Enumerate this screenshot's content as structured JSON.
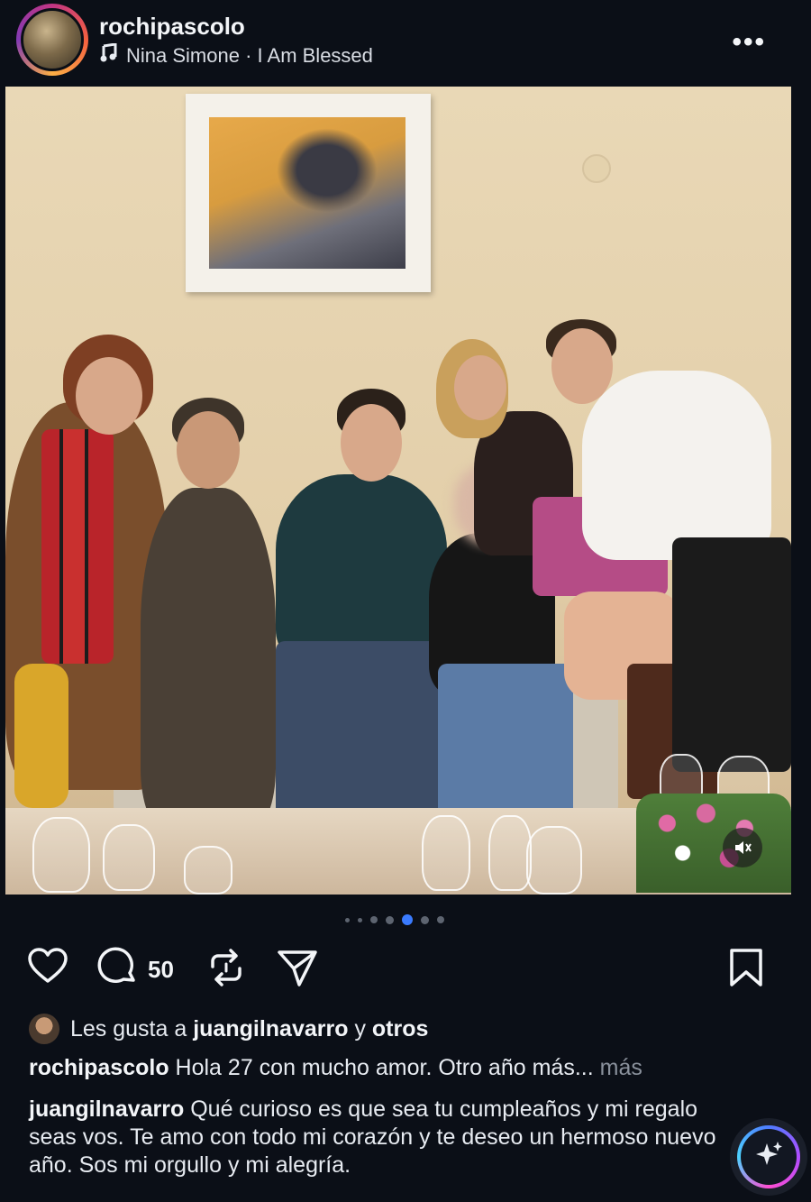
{
  "post": {
    "username": "rochipascolo",
    "music": "Nina Simone · I Am Blessed",
    "more_label": "•••"
  },
  "carousel": {
    "slide_count": 7,
    "active_index": 4
  },
  "actions": {
    "comment_count": "50"
  },
  "likes": {
    "prefix": "Les gusta a",
    "user": "juangilnavarro",
    "connector": "y",
    "others": "otros"
  },
  "caption": {
    "user": "rochipascolo",
    "text": "Hola 27 con mucho amor. Otro año más...",
    "more": "más"
  },
  "comment": {
    "user": "juangilnavarro",
    "text": "Qué curioso es que sea tu cumpleaños y mi regalo seas vos. Te amo con todo mi corazón y  te deseo un hermoso nuevo año. Sos mi orgullo y mi alegría."
  },
  "icons": {
    "like": "heart-icon",
    "comment": "comment-bubble-icon",
    "repost": "repost-icon",
    "share": "send-icon",
    "save": "bookmark-icon",
    "music": "music-note-icon",
    "mute": "speaker-muted-icon",
    "ai": "sparkle-icon"
  },
  "colors": {
    "background": "#0b0f17",
    "text": "#e9edf3",
    "secondary": "#8a919c",
    "active_dot": "#3a7bff"
  }
}
